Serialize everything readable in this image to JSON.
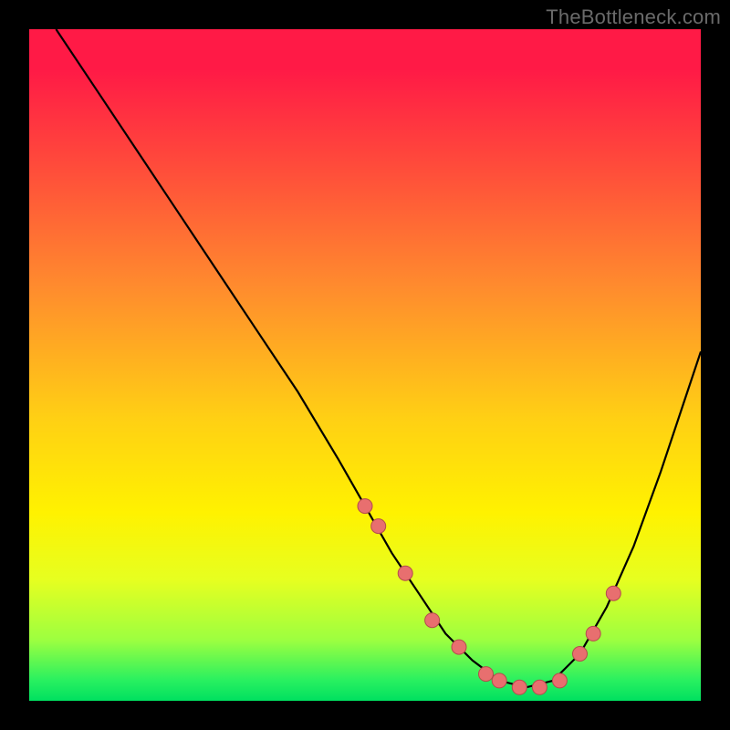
{
  "watermark": "TheBottleneck.com",
  "chart_data": {
    "type": "line",
    "title": "",
    "xlabel": "",
    "ylabel": "",
    "xlim": [
      0,
      100
    ],
    "ylim": [
      0,
      100
    ],
    "series": [
      {
        "name": "bottleneck-curve",
        "x": [
          4,
          10,
          16,
          22,
          28,
          34,
          40,
          46,
          50,
          54,
          58,
          62,
          66,
          70,
          74,
          78,
          82,
          86,
          90,
          94,
          98,
          100
        ],
        "y": [
          100,
          91,
          82,
          73,
          64,
          55,
          46,
          36,
          29,
          22,
          16,
          10,
          6,
          3,
          2,
          3,
          7,
          14,
          23,
          34,
          46,
          52
        ]
      }
    ],
    "markers": {
      "name": "highlighted-points",
      "x": [
        50,
        52,
        56,
        60,
        64,
        68,
        70,
        73,
        76,
        79,
        82,
        84,
        87
      ],
      "y": [
        29,
        26,
        19,
        12,
        8,
        4,
        3,
        2,
        2,
        3,
        7,
        10,
        16
      ]
    },
    "colors": {
      "gradient_top": "#ff1a46",
      "gradient_mid": "#fff200",
      "gradient_bottom": "#00e060",
      "curve": "#000000",
      "marker_fill": "#e86f6f",
      "marker_stroke": "#b44c4c",
      "background": "#000000"
    }
  }
}
